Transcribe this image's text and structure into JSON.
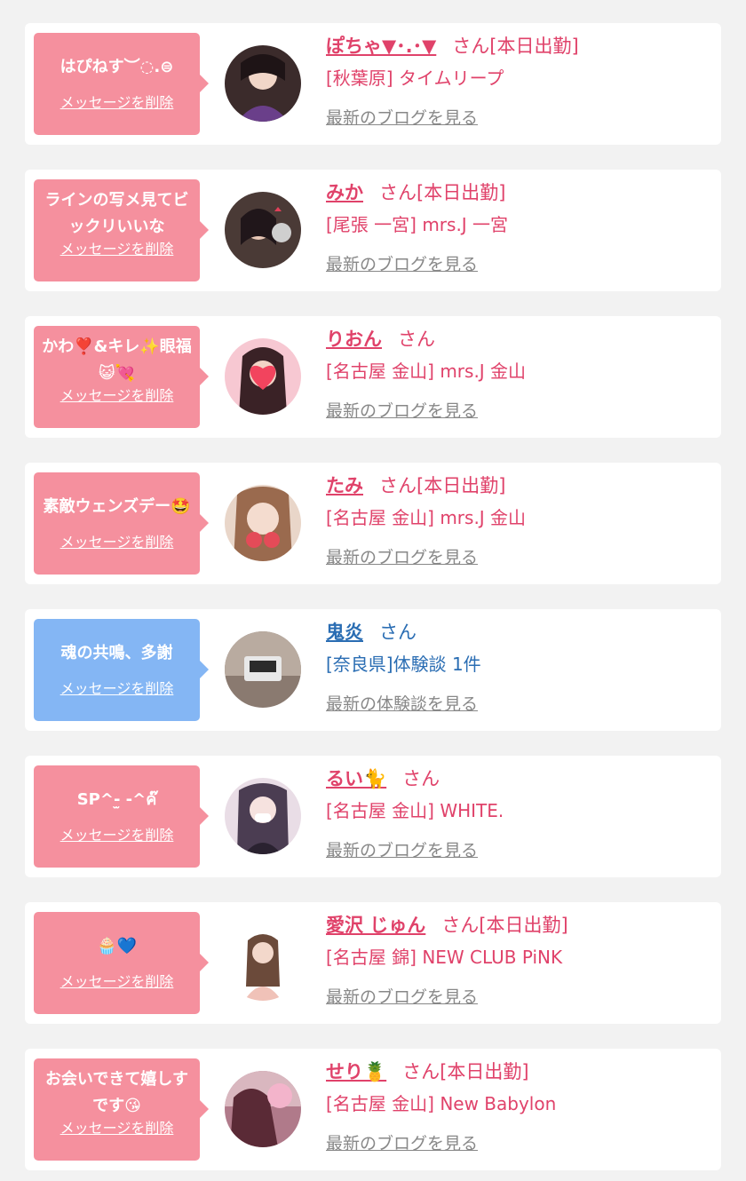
{
  "cards": [
    {
      "message": "はぴねす︶◌.⊜",
      "delete_label": "メッセージを削除",
      "name": "ぽちゃ▼･.･▼",
      "suffix": "さん[本日出勤]",
      "shop": "[秋葉原] タイムリープ",
      "link": "最新のブログを見る",
      "bubble_color": "#f5909e",
      "avatar_color": "#3b2b2b"
    },
    {
      "message": "ラインの写メ見てビックリいいな",
      "delete_label": "メッセージを削除",
      "name": "みか",
      "suffix": "さん[本日出勤]",
      "shop": "[尾張 一宮] mrs.J 一宮",
      "link": "最新のブログを見る",
      "bubble_color": "#f5909e",
      "avatar_color": "#4a3a36"
    },
    {
      "message": "かわ❣️&キレ✨眼福😺💘",
      "delete_label": "メッセージを削除",
      "name": "りおん",
      "suffix": "さん",
      "shop": "[名古屋 金山] mrs.J 金山",
      "link": "最新のブログを見る",
      "bubble_color": "#f5909e",
      "avatar_color": "#f7c8d2"
    },
    {
      "message": "素敵ウェンズデー🤩",
      "delete_label": "メッセージを削除",
      "name": "たみ",
      "suffix": "さん[本日出勤]",
      "shop": "[名古屋 金山] mrs.J 金山",
      "link": "最新のブログを見る",
      "bubble_color": "#f5909e",
      "avatar_color": "#e9d6c9"
    },
    {
      "message": "魂の共鳴、多謝",
      "delete_label": "メッセージを削除",
      "name": "鬼炎",
      "suffix": "さん",
      "shop": "[奈良県]体験談 1件",
      "link": "最新の体験談を見る",
      "bubble_color": "#84b6f4",
      "avatar_color": "#8a7a70"
    },
    {
      "message": "SP^-̫ -^ค๊",
      "delete_label": "メッセージを削除",
      "name": "るい🐈",
      "suffix": "さん",
      "shop": "[名古屋 金山] WHITE.",
      "link": "最新のブログを見る",
      "bubble_color": "#f5909e",
      "avatar_color": "#e9dde6"
    },
    {
      "message": "🧁💙",
      "delete_label": "メッセージを削除",
      "name": "愛沢 じゅん",
      "suffix": "さん[本日出勤]",
      "shop": "[名古屋 錦] NEW CLUB PiNK",
      "link": "最新のブログを見る",
      "bubble_color": "#f5909e",
      "avatar_color": "#ffffff"
    },
    {
      "message": "お会いできて嬉しすです😘",
      "delete_label": "メッセージを削除",
      "name": "せり🍍",
      "suffix": "さん[本日出勤]",
      "shop": "[名古屋 金山] New Babylon",
      "link": "最新のブログを見る",
      "bubble_color": "#f5909e",
      "avatar_color": "#b07a8a"
    }
  ]
}
